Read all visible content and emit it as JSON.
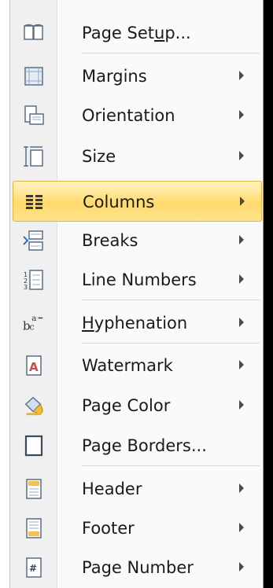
{
  "menu": {
    "items": [
      {
        "id": "page-setup",
        "label": "Page Setup...",
        "submenu": false,
        "icon": "page-setup-icon"
      },
      {
        "id": "margins",
        "label": "Margins",
        "submenu": true,
        "icon": "margins-icon"
      },
      {
        "id": "orientation",
        "label": "Orientation",
        "submenu": true,
        "icon": "orientation-icon"
      },
      {
        "id": "size",
        "label": "Size",
        "submenu": true,
        "icon": "size-icon"
      },
      {
        "id": "columns",
        "label": "Columns",
        "submenu": true,
        "icon": "columns-icon",
        "highlighted": true
      },
      {
        "id": "breaks",
        "label": "Breaks",
        "submenu": true,
        "icon": "breaks-icon"
      },
      {
        "id": "line-numbers",
        "label": "Line Numbers",
        "submenu": true,
        "icon": "line-numbers-icon"
      },
      {
        "id": "hyphenation",
        "label": "Hyphenation",
        "submenu": true,
        "icon": "hyphenation-icon"
      },
      {
        "id": "watermark",
        "label": "Watermark",
        "submenu": true,
        "icon": "watermark-icon"
      },
      {
        "id": "page-color",
        "label": "Page Color",
        "submenu": true,
        "icon": "page-color-icon"
      },
      {
        "id": "page-borders",
        "label": "Page Borders...",
        "submenu": false,
        "icon": "page-borders-icon"
      },
      {
        "id": "header",
        "label": "Header",
        "submenu": true,
        "icon": "header-icon"
      },
      {
        "id": "footer",
        "label": "Footer",
        "submenu": true,
        "icon": "footer-icon"
      },
      {
        "id": "page-number",
        "label": "Page Number",
        "submenu": true,
        "icon": "page-number-icon"
      }
    ]
  },
  "colors": {
    "highlight_top": "#fff3c4",
    "highlight_mid": "#ffd96c",
    "highlight_border": "#e3b53c"
  }
}
